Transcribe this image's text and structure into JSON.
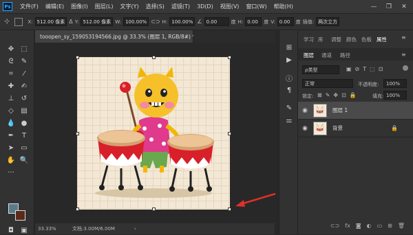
{
  "menubar": {
    "logo": "Ps",
    "items": [
      "文件(F)",
      "编辑(E)",
      "图像(I)",
      "图层(L)",
      "文字(Y)",
      "选择(S)",
      "滤镜(T)",
      "3D(D)",
      "视图(V)",
      "窗口(W)",
      "帮助(H)"
    ],
    "minimize": "—",
    "restore": "❐",
    "close": "✕"
  },
  "options": {
    "x_label": "X:",
    "x_value": "512.00 像素",
    "y_label": "Y:",
    "y_value": "512.00 像素",
    "w_label": "W:",
    "w_value": "100.00%",
    "h_label": "H:",
    "h_value": "100.00%",
    "angle_value": "0.00",
    "angle_unit": "度",
    "hskew_label": "H:",
    "hskew_value": "0.00",
    "hskew_unit": "度",
    "vskew_label": "V:",
    "vskew_value": "0.00",
    "vskew_unit": "度",
    "interp_label": "插值:",
    "interp_value": "两次立方"
  },
  "document": {
    "tab_title": "tooopen_sy_159053194566.jpg @ 33.3% (图层 1, RGB/8#) *",
    "tab_close": "×",
    "zoom": "33.33%",
    "doc_info": "文档:3.00M/6.00M"
  },
  "panel": {
    "top_tabs": [
      "学习",
      "库",
      "调整",
      "颜色",
      "色板",
      "属性"
    ],
    "active_top_tab": "属性",
    "layer_tabs": [
      "图层",
      "通道",
      "路径"
    ],
    "active_layer_tab": "图层",
    "kind_select": "ρ类型",
    "blend_mode": "正常",
    "opacity_label": "不透明度:",
    "opacity_value": "100%",
    "lock_label": "锁定:",
    "fill_label": "填充:",
    "fill_value": "100%",
    "layers": [
      {
        "name": "图层 1",
        "selected": true,
        "locked": false
      },
      {
        "name": "背景",
        "selected": false,
        "locked": true
      }
    ],
    "bottom_icons": [
      "link-icon",
      "fx-icon",
      "mask-icon",
      "adjustment-icon",
      "group-icon",
      "new-layer-icon",
      "trash-icon"
    ]
  },
  "colors": {
    "foreground": "#5a7a8c",
    "background": "#5a2a1a",
    "arrow": "#e0302a",
    "canvas_bg": "#f3e8d5"
  }
}
